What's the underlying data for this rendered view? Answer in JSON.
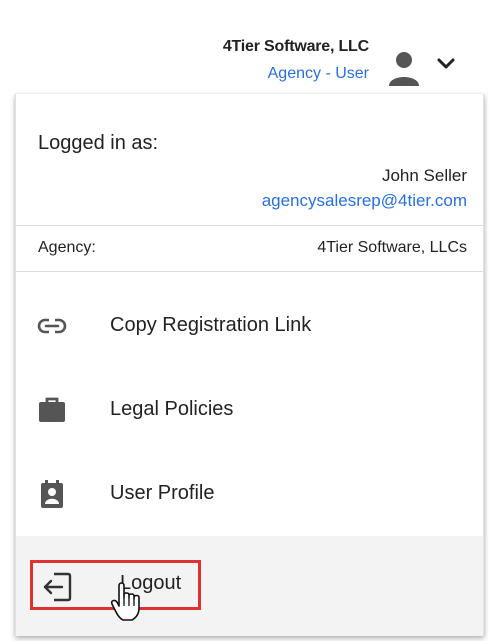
{
  "header": {
    "org_name": "4Tier Software, LLC",
    "role": "Agency - User",
    "user_icon": "person-icon",
    "expand_icon": "chevron-down-icon"
  },
  "menu": {
    "logged_in_label": "Logged in as:",
    "user_name": "John Seller",
    "user_email": "agencysalesrep@4tier.com",
    "agency_label": "Agency:",
    "agency_value": "4Tier Software, LLCs",
    "items": [
      {
        "label": "Copy Registration Link",
        "icon": "link-icon"
      },
      {
        "label": "Legal Policies",
        "icon": "briefcase-icon"
      },
      {
        "label": "User Profile",
        "icon": "contact-card-icon"
      },
      {
        "label": "Logout",
        "icon": "logout-icon"
      }
    ]
  },
  "colors": {
    "link_blue": "#2a6fdb",
    "highlight_red": "#e03131",
    "icon_gray": "#555555",
    "hover_bg": "#f3f3f3"
  }
}
